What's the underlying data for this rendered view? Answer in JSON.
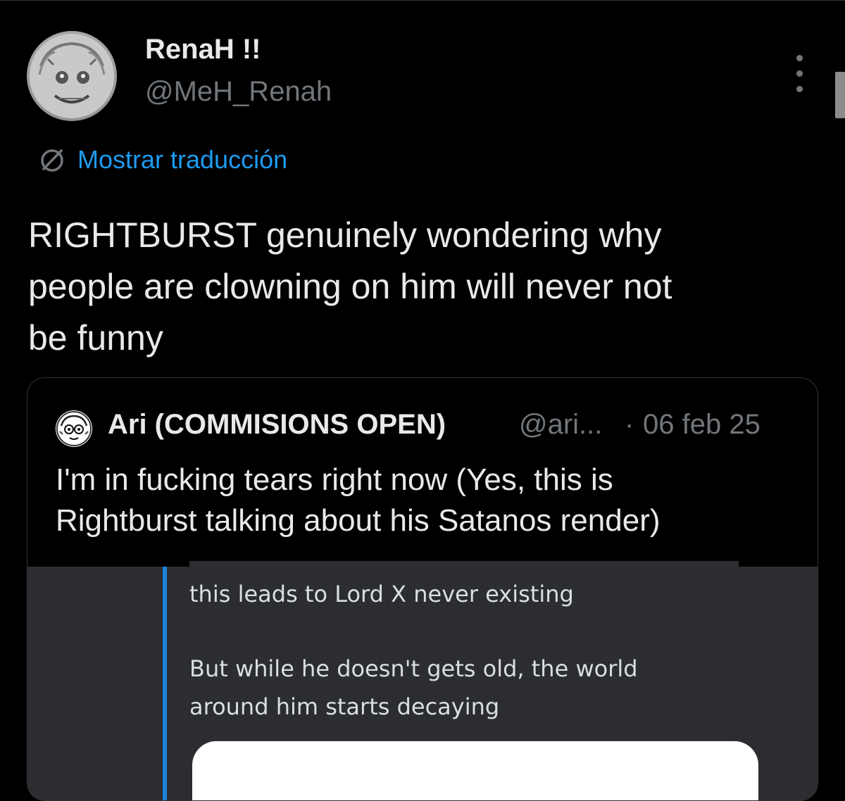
{
  "author": {
    "display_name": "RenaH !!",
    "handle": "@MeH_Renah",
    "avatar_icon": "grayscale-drawn-character-avatar"
  },
  "menu": {
    "icon": "more-vertical-icon"
  },
  "translate": {
    "icon": "translate-globe-icon",
    "label": "Mostrar traducción",
    "color": "#1d9bf0"
  },
  "tweet": {
    "lines": [
      "RIGHTBURST genuinely wondering why",
      "people are clowning on him will never not",
      "be funny"
    ]
  },
  "quote": {
    "display_name": "Ari (COMMISIONS OPEN)",
    "handle": "@ari...",
    "separator": "·",
    "date": "06 feb 25",
    "lines": [
      "I'm in fucking tears right now (Yes, this is",
      "Rightburst talking about his Satanos render)"
    ],
    "media": {
      "lines": [
        "this leads to Lord X never existing",
        "But while he doesn't gets old, the world",
        "around him starts decaying"
      ],
      "accent_color": "#1e82d9",
      "background_color": "#2b2d31"
    }
  },
  "colors": {
    "background": "#000000",
    "text_primary": "#e7e9ea",
    "text_secondary": "#71767b",
    "link": "#1d9bf0"
  }
}
